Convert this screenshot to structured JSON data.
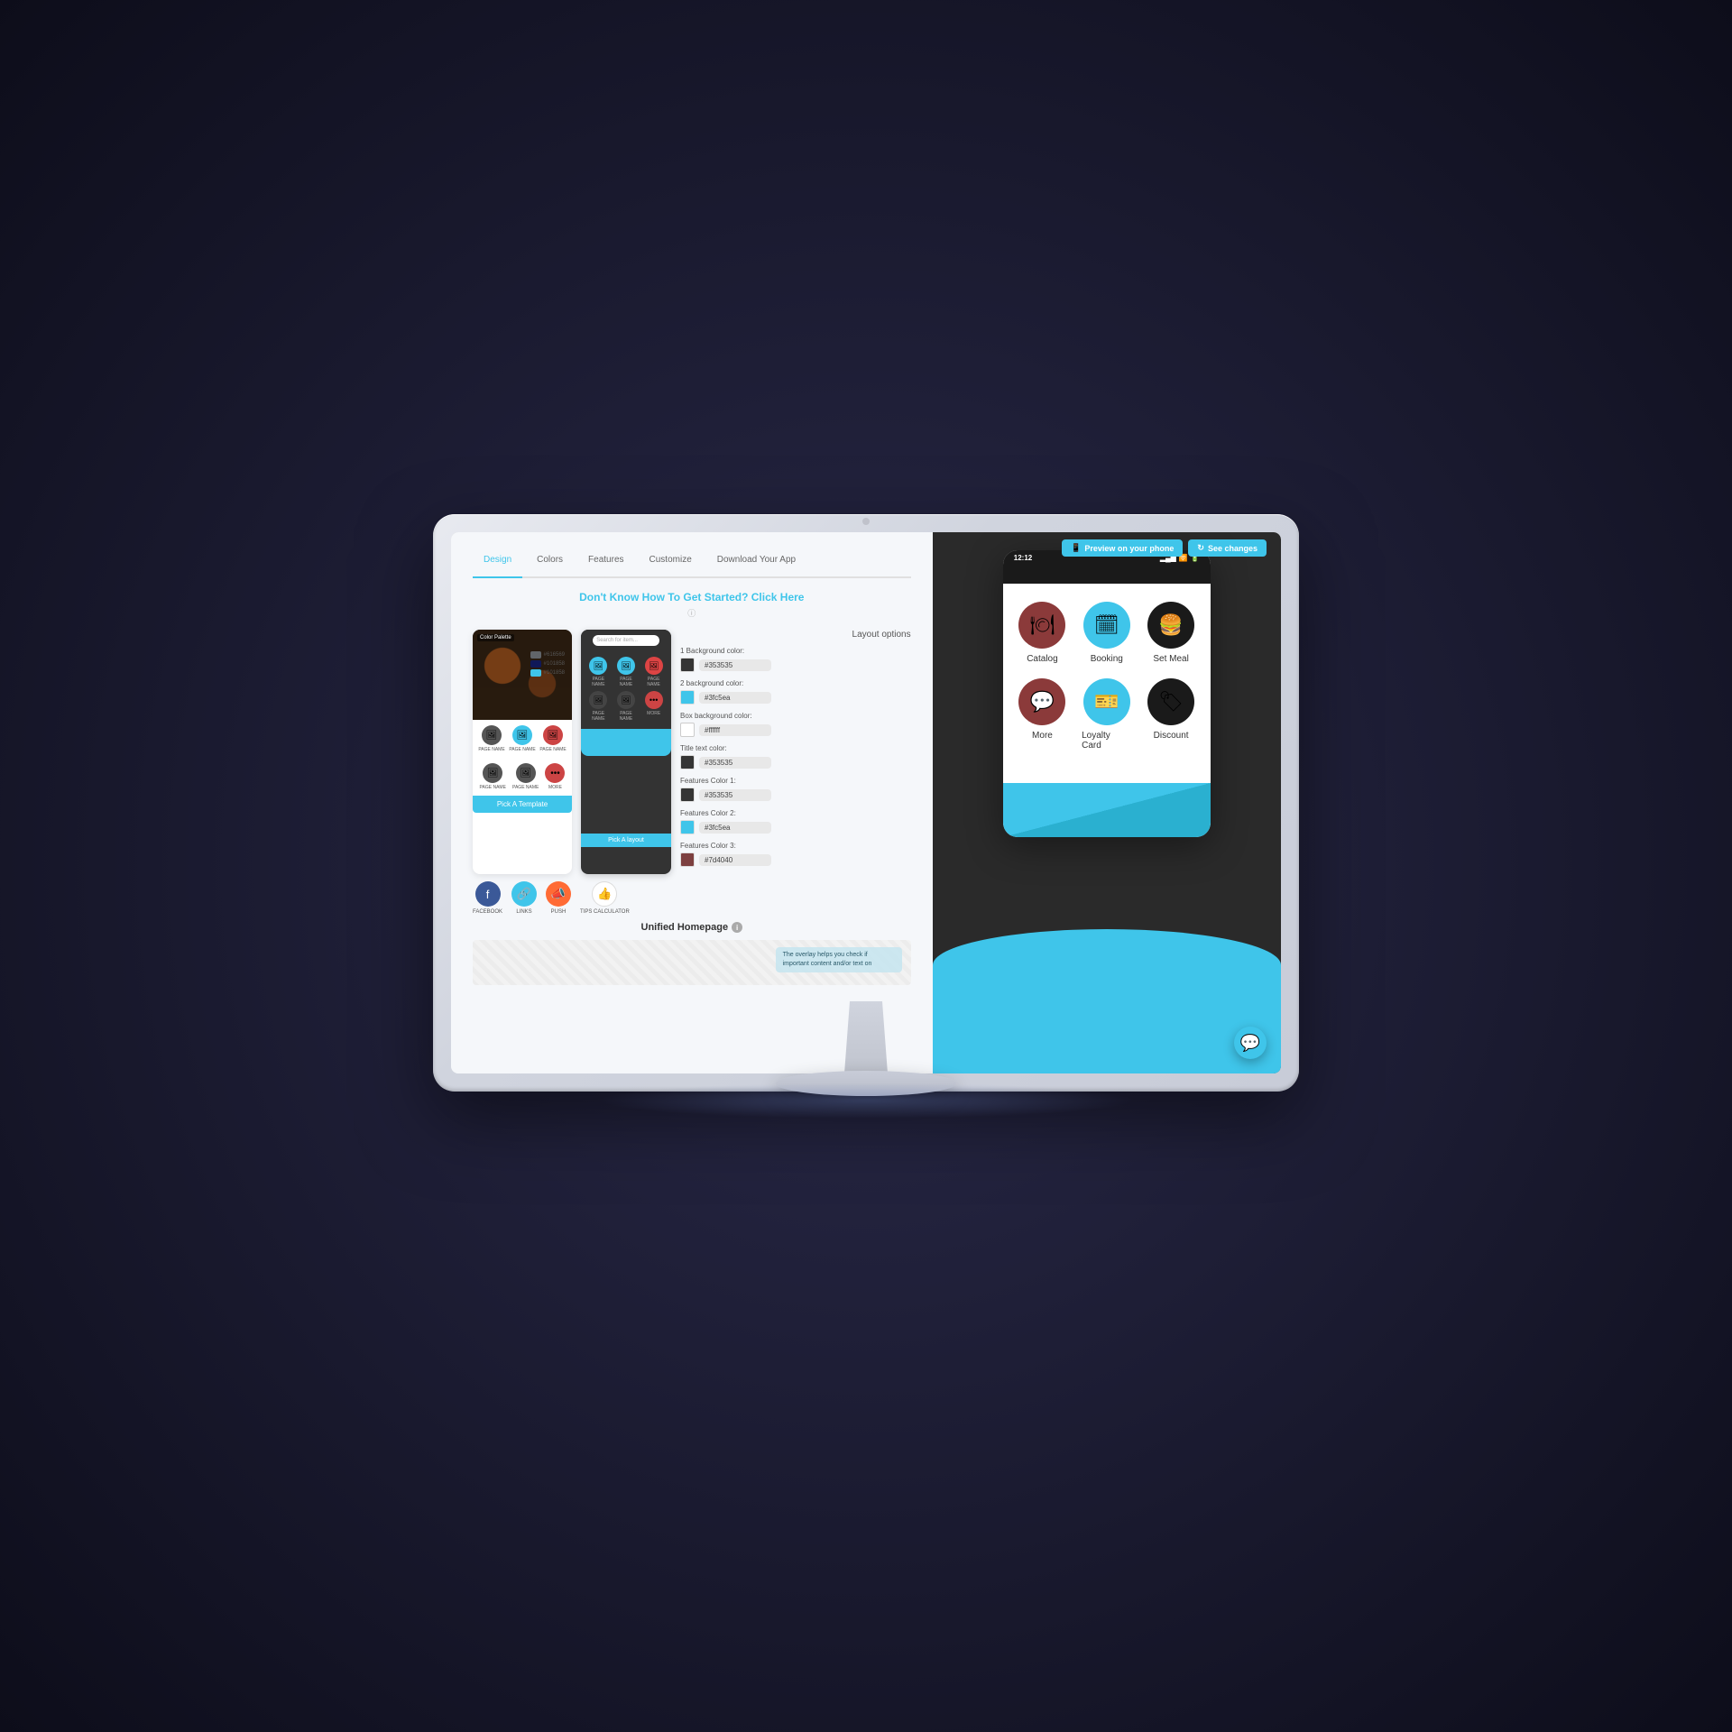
{
  "topBar": {
    "previewLabel": "Preview on your phone",
    "changesLabel": "See changes"
  },
  "tabs": {
    "items": [
      {
        "id": "design",
        "label": "Design",
        "active": true
      },
      {
        "id": "colors",
        "label": "Colors"
      },
      {
        "id": "features",
        "label": "Features"
      },
      {
        "id": "customize",
        "label": "Customize"
      },
      {
        "id": "download",
        "label": "Download Your App"
      }
    ]
  },
  "headline": {
    "static": "Don't Know How To Get Started?",
    "link": "Click Here"
  },
  "layoutOptions": {
    "title": "Layout options",
    "color1Label": "1 Background color:",
    "color1Value": "#353535",
    "color2Label": "2 background color:",
    "color2Value": "#3fc5ea",
    "boxBgLabel": "Box background color:",
    "boxBgValue": "#ffffff",
    "titleTextLabel": "Title text color:",
    "titleTextValue": "#353535",
    "featColor1Label": "Features Color 1:",
    "featColor1Value": "#353535",
    "featColor2Label": "Features Color 2:",
    "featColor2Value": "#3fc5ea",
    "featColor3Label": "Features Color 3:",
    "featColor3Value": "#7d4040"
  },
  "pickTemplate": "Pick A Template",
  "pickLayout": "Pick A layout",
  "unifiedHomepage": "Unified Homepage",
  "overlayText": "The overlay helps you check if important content and/or text on",
  "social": {
    "facebook": "FACEBOOK",
    "links": "LINKS",
    "push": "PUSH",
    "tips": "TIPS CALCULATOR"
  },
  "phone": {
    "time": "12:12",
    "apps": [
      {
        "label": "Catalog",
        "icon": "🍽",
        "bg": "catalog-bg"
      },
      {
        "label": "Booking",
        "icon": "📅",
        "bg": "booking-bg"
      },
      {
        "label": "Set Meal",
        "icon": "🍔",
        "bg": "setmeal-bg"
      },
      {
        "label": "More",
        "icon": "💬",
        "bg": "more-bg"
      },
      {
        "label": "Loyalty Card",
        "icon": "🎫",
        "bg": "loyalty-bg"
      },
      {
        "label": "Discount",
        "icon": "🏷",
        "bg": "discount-bg"
      }
    ]
  },
  "colorPaletteLabel": "Color Palette",
  "swatches": [
    {
      "color": "#616569",
      "label": "#616569"
    },
    {
      "color": "#101858",
      "label": "#101858"
    },
    {
      "color": "#101858",
      "label": "#101858"
    }
  ],
  "searchPlaceholder": "Search for item...",
  "layoutIcons": [
    {
      "label": "PAGE NAME",
      "color": "teal"
    },
    {
      "label": "PAGE NAME",
      "color": "teal"
    },
    {
      "label": "PAGE NAME",
      "color": "red"
    },
    {
      "label": "PAGE NAME",
      "color": "dark"
    },
    {
      "label": "PAGE NAME",
      "color": "dark"
    },
    {
      "label": "MORE",
      "color": "more"
    }
  ]
}
